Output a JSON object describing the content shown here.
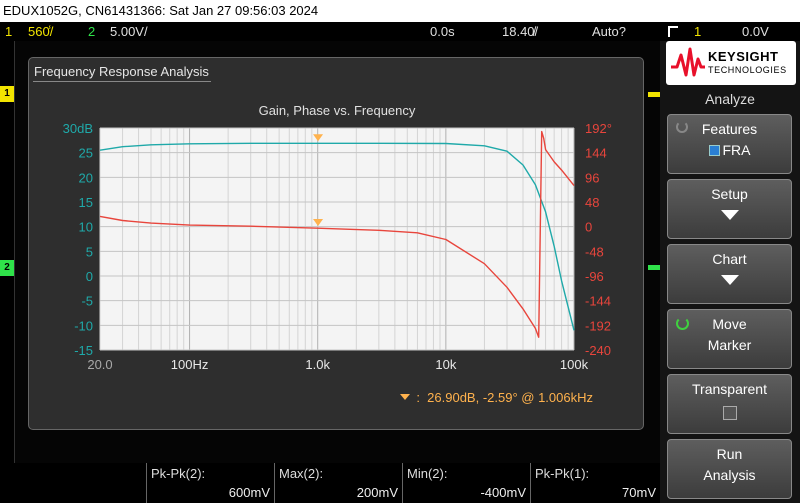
{
  "title_bar": {
    "text": "EDUX1052G, CN61431366: Sat Jan 27 09:56:03 2024"
  },
  "status_bar": {
    "ch1_num": "1",
    "ch1_scale": "560̾/",
    "ch2_num": "2",
    "ch2_scale": "5.00V/",
    "time_offset": "0.0s",
    "timebase": "18.40̸/",
    "trigger_mode": "Auto?",
    "trigger_channel": "1",
    "trigger_level": "0.0V"
  },
  "side_markers": {
    "ch1": "1",
    "ch2": "2"
  },
  "fra": {
    "panel_title": "Frequency Response Analysis",
    "marker_readout": "26.90dB, -2.59° @ 1.006kHz"
  },
  "chart_data": {
    "type": "line",
    "title": "Gain, Phase vs. Frequency",
    "x_scale": "log",
    "xlim": [
      20,
      100000
    ],
    "x_tick_labels": [
      "20.0",
      "100Hz",
      "1.0k",
      "10k",
      "100k"
    ],
    "x_tick_values": [
      20,
      100,
      1000,
      10000,
      100000
    ],
    "ylim_gain": [
      -15,
      30
    ],
    "y_gain_ticks": [
      "30dB",
      "25",
      "20",
      "15",
      "10",
      "5",
      "0",
      "-5",
      "-10",
      "-15"
    ],
    "ylim_phase": [
      -240,
      192
    ],
    "y_phase_ticks": [
      "192°",
      "144",
      "96",
      "48",
      "0",
      "-48",
      "-96",
      "-144",
      "-192",
      "-240"
    ],
    "grid": true,
    "marker": {
      "x": 1006,
      "gain": 26.9,
      "phase": -2.59
    },
    "series": [
      {
        "color": "#1fa9a9",
        "axis": "gain",
        "x": [
          20,
          30,
          50,
          100,
          300,
          1000,
          3000,
          10000,
          20000,
          30000,
          40000,
          50000,
          60000,
          70000,
          80000,
          100000
        ],
        "y": [
          25.5,
          26.2,
          26.6,
          26.8,
          26.9,
          26.9,
          26.9,
          26.85,
          26.4,
          25.3,
          22.5,
          18.5,
          13,
          6,
          -1,
          -11
        ]
      },
      {
        "color": "#e8453c",
        "axis": "phase",
        "x": [
          20,
          30,
          50,
          100,
          300,
          1000,
          3000,
          6000,
          10000,
          20000,
          30000,
          40000,
          50000,
          53000,
          56000,
          58000,
          60000,
          70000,
          80000,
          100000
        ],
        "y": [
          20,
          12,
          7,
          3,
          1,
          -3,
          -7,
          -12,
          -25,
          -72,
          -118,
          -160,
          -198,
          -215,
          185,
          172,
          150,
          126,
          110,
          80
        ]
      }
    ]
  },
  "measurements": [
    {
      "label": "Pk-Pk(2):",
      "value": "600mV"
    },
    {
      "label": "Max(2):",
      "value": "200mV"
    },
    {
      "label": "Min(2):",
      "value": "-400mV"
    },
    {
      "label": "Pk-Pk(1):",
      "value": "70mV"
    }
  ],
  "right_panel": {
    "brand_line1": "KEYSIGHT",
    "brand_line2": "TECHNOLOGIES",
    "menu_title": "Analyze",
    "features_label": "Features",
    "features_value": "FRA",
    "setup_label": "Setup",
    "chart_label": "Chart",
    "move_label": "Move",
    "marker_label": "Marker",
    "transparent_label": "Transparent",
    "run_label": "Run",
    "analysis_label": "Analysis"
  },
  "colors": {
    "ch1": "#f2e400",
    "ch2": "#2fe24a",
    "gain": "#1fa9a9",
    "phase": "#e8453c",
    "marker": "#ffb24d"
  }
}
